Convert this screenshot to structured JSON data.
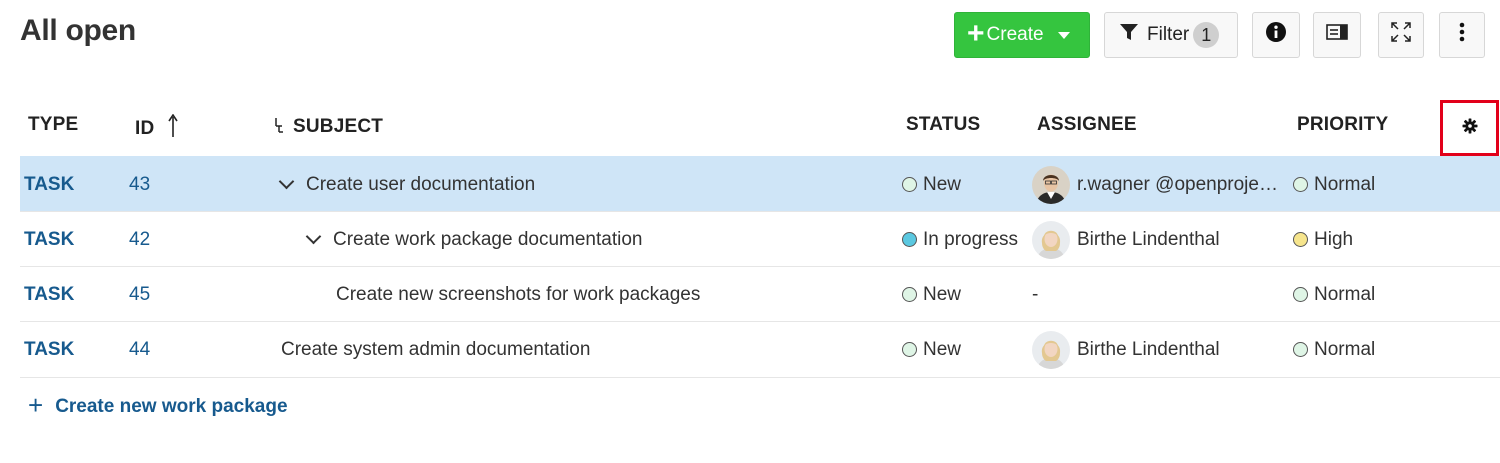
{
  "page_title": "All open",
  "toolbar": {
    "create_label": "Create",
    "filter_label": "Filter",
    "filter_count": "1"
  },
  "columns": {
    "type": "TYPE",
    "id": "ID",
    "subject": "SUBJECT",
    "status": "STATUS",
    "assignee": "ASSIGNEE",
    "priority": "PRIORITY"
  },
  "sort": {
    "column": "ID",
    "direction": "ascending"
  },
  "rows": [
    {
      "type": "TASK",
      "id": "43",
      "subject": "Create user documentation",
      "expanded": true,
      "level": 0,
      "status": "New",
      "status_color": "#dff5e6",
      "assignee": "r.wagner @openproje…",
      "assignee_avatar": "male-avatar",
      "priority": "Normal",
      "priority_color": "#dff5e6",
      "selected": true
    },
    {
      "type": "TASK",
      "id": "42",
      "subject": "Create work package documentation",
      "expanded": true,
      "level": 1,
      "status": "In progress",
      "status_color": "#5bc8e0",
      "assignee": "Birthe Lindenthal",
      "assignee_avatar": "female-avatar",
      "priority": "High",
      "priority_color": "#f6e58d",
      "selected": false
    },
    {
      "type": "TASK",
      "id": "45",
      "subject": "Create new screenshots for work packages",
      "expanded": false,
      "level": 2,
      "status": "New",
      "status_color": "#dff5e6",
      "assignee": "-",
      "assignee_avatar": "",
      "priority": "Normal",
      "priority_color": "#dff5e6",
      "selected": false
    },
    {
      "type": "TASK",
      "id": "44",
      "subject": "Create system admin documentation",
      "expanded": false,
      "level": 0,
      "status": "New",
      "status_color": "#dff5e6",
      "assignee": "Birthe Lindenthal",
      "assignee_avatar": "female-avatar",
      "priority": "Normal",
      "priority_color": "#dff5e6",
      "selected": false
    }
  ],
  "create_new_label": "Create new work package",
  "colors": {
    "create_button": "#35c53f",
    "link_blue": "#175a8e",
    "selected_row": "#cfe5f7",
    "highlight_frame": "#e2001a"
  }
}
